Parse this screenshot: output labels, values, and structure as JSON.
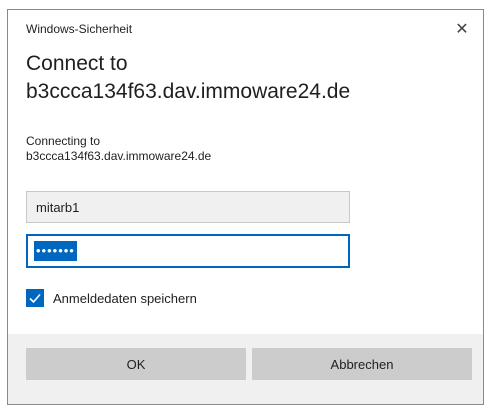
{
  "window": {
    "title": "Windows-Sicherheit",
    "close_glyph": "✕"
  },
  "heading": {
    "line1": "Connect to",
    "line2": "b3ccca134f63.dav.immoware24.de"
  },
  "subtext": {
    "line1": "Connecting to",
    "line2": "b3ccca134f63.dav.immoware24.de"
  },
  "username": {
    "value": "mitarb1"
  },
  "password": {
    "masked_value": "•••••••"
  },
  "remember": {
    "label": "Anmeldedaten speichern",
    "checked": true
  },
  "buttons": {
    "ok_label": "OK",
    "cancel_label": "Abbrechen"
  },
  "colors": {
    "accent": "#0067c0",
    "footer_bg": "#f0f0f0",
    "button_bg": "#cccccc"
  },
  "icons": {
    "close": "close-icon",
    "checkmark": "checkmark-icon"
  }
}
